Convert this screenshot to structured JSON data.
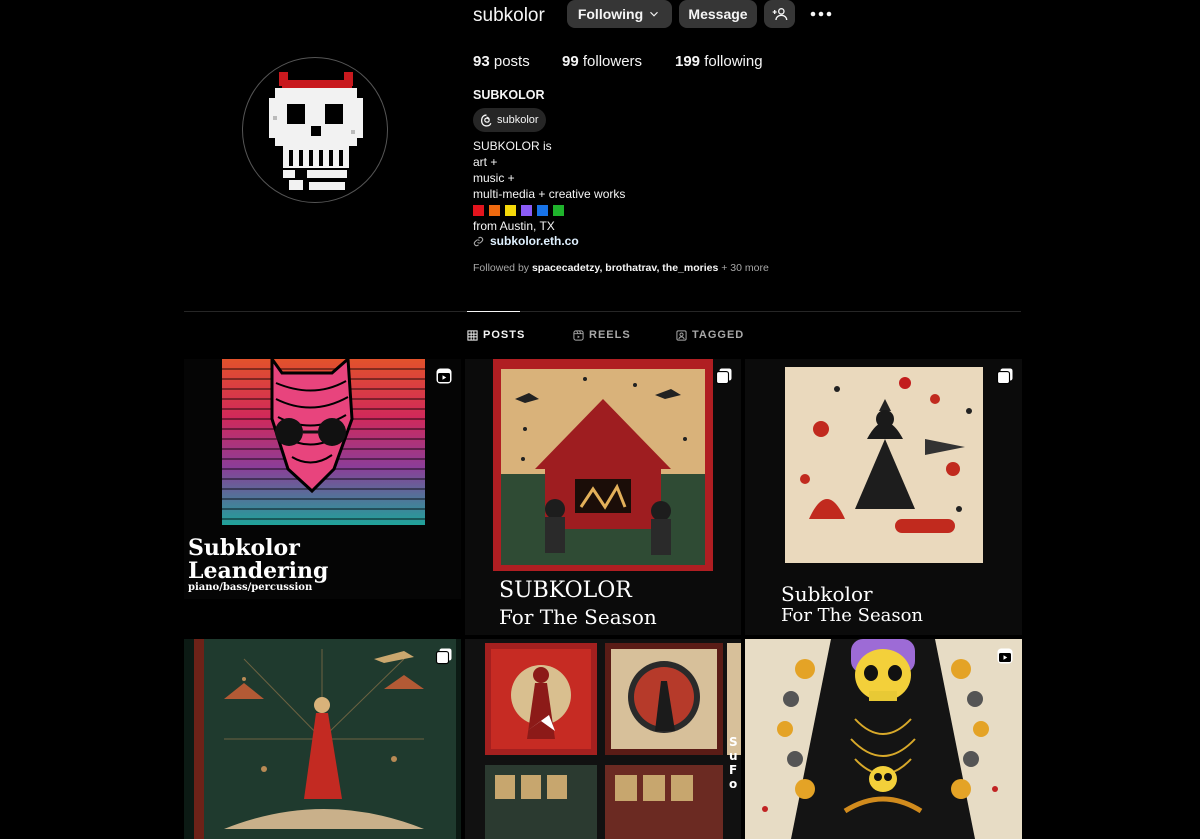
{
  "profile": {
    "username": "subkolor",
    "following_label": "Following",
    "message_label": "Message",
    "posts_count": "93",
    "posts_label": "posts",
    "followers_count": "99",
    "followers_label": "followers",
    "following_count": "199",
    "following_count_label": "following",
    "full_name": "SUBKOLOR",
    "threads_handle": "subkolor",
    "bio_lines": [
      "SUBKOLOR is",
      "art +",
      "music +",
      "multi-media + creative works"
    ],
    "bio_color_squares": [
      "#e3141d",
      "#f06a0f",
      "#f5d90a",
      "#8b5cf6",
      "#1873e8",
      "#1fb32c"
    ],
    "location": "from Austin, TX",
    "link": "subkolor.eth.co",
    "followed_by_prefix": "Followed by",
    "followed_by_names": "spacecadetzy, brothatrav, the_mories",
    "followed_by_more": "+ 30 more"
  },
  "tabs": [
    {
      "label": "POSTS",
      "icon": "grid-icon",
      "active": true
    },
    {
      "label": "REELS",
      "icon": "reels-icon",
      "active": false
    },
    {
      "label": "TAGGED",
      "icon": "tagged-icon",
      "active": false
    }
  ],
  "posts": [
    {
      "type": "reel",
      "icon": "reel-icon",
      "title_line1": "Subkolor",
      "title_line2": "Leandering",
      "subtitle": "piano/bass/percussion"
    },
    {
      "type": "carousel",
      "icon": "carousel-icon",
      "title_line1": "SUBKOLOR",
      "title_line2": "For The Season"
    },
    {
      "type": "carousel",
      "icon": "carousel-icon",
      "title_line1": "Subkolor",
      "title_line2": "For The Season"
    },
    {
      "type": "carousel",
      "icon": "carousel-icon"
    },
    {
      "type": "image",
      "icon": "",
      "side_text": "Su Fo"
    },
    {
      "type": "reel",
      "icon": "reel-icon"
    }
  ],
  "colors": {
    "background": "#000000",
    "button": "#363636",
    "muted_text": "#a8a8a8",
    "link": "#e0f1ff"
  }
}
